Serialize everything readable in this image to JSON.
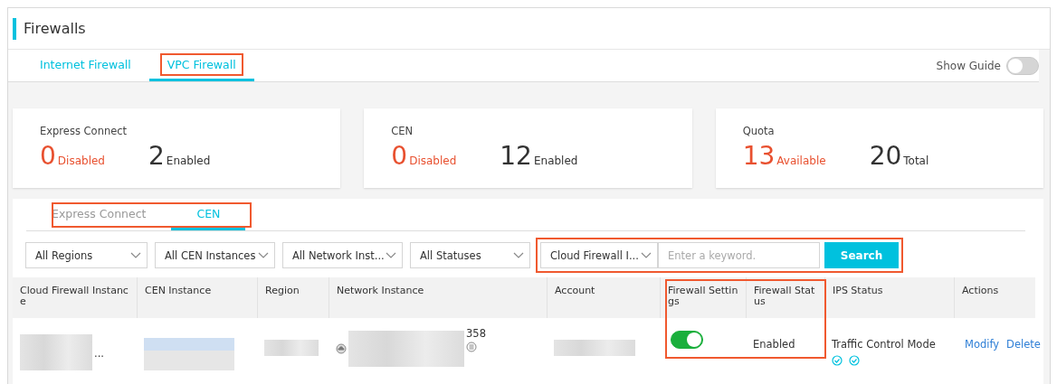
{
  "page": {
    "title": "Firewalls"
  },
  "tabs": [
    {
      "label": "Internet Firewall",
      "selected": false,
      "annotated": false
    },
    {
      "label": "VPC Firewall",
      "selected": true,
      "annotated": true
    }
  ],
  "show_guide": {
    "label": "Show Guide",
    "on": false
  },
  "summary_cards": [
    {
      "title": "Express Connect",
      "stats": [
        {
          "value": "0",
          "label": "Disabled",
          "kind": "alert"
        },
        {
          "value": "2",
          "label": "Enabled",
          "kind": "plain"
        }
      ]
    },
    {
      "title": "CEN",
      "stats": [
        {
          "value": "0",
          "label": "Disabled",
          "kind": "alert"
        },
        {
          "value": "12",
          "label": "Enabled",
          "kind": "plain"
        }
      ]
    },
    {
      "title": "Quota",
      "stats": [
        {
          "value": "13",
          "label": "Available",
          "kind": "alert"
        },
        {
          "value": "20",
          "label": "Total",
          "kind": "plain"
        }
      ]
    }
  ],
  "sub_tabs": {
    "annotated": true,
    "items": [
      {
        "label": "Express Connect",
        "selected": false
      },
      {
        "label": "CEN",
        "selected": true
      }
    ]
  },
  "filters": [
    {
      "value": "All Regions"
    },
    {
      "value": "All CEN Instances"
    },
    {
      "value": "All Network Inst..."
    },
    {
      "value": "All Statuses"
    }
  ],
  "search": {
    "annotated": true,
    "field_select": "Cloud Firewall I...",
    "placeholder": "Enter a keyword.",
    "button": "Search"
  },
  "table": {
    "columns": [
      {
        "label": "Cloud Firewall Instance",
        "annotated": false
      },
      {
        "label": "CEN Instance",
        "annotated": false
      },
      {
        "label": "Region",
        "annotated": false
      },
      {
        "label": "Network Instance",
        "annotated": false
      },
      {
        "label": "Account",
        "annotated": false
      },
      {
        "label": "Firewall Settings",
        "annotated": true
      },
      {
        "label": "Firewall Status",
        "annotated": true
      },
      {
        "label": "IPS Status",
        "annotated": false
      },
      {
        "label": "Actions",
        "annotated": false
      }
    ],
    "rows": [
      {
        "cells": [
          {
            "kind": "redacted",
            "suffix": "..."
          },
          {
            "kind": "redacted-link"
          },
          {
            "kind": "redacted"
          },
          {
            "kind": "network",
            "text": "358"
          },
          {
            "kind": "redacted"
          },
          {
            "kind": "switch",
            "on": true
          },
          {
            "kind": "text",
            "text": "Enabled"
          },
          {
            "kind": "ips",
            "text": "Traffic Control Mode"
          },
          {
            "kind": "actions",
            "links": [
              "Modify",
              "Delete"
            ]
          }
        ]
      }
    ]
  }
}
